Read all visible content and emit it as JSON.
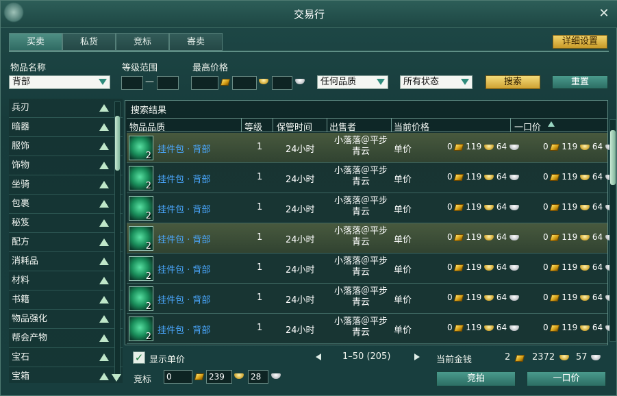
{
  "window": {
    "title": "交易行"
  },
  "tabs": [
    {
      "label": "买卖",
      "active": true
    },
    {
      "label": "私货",
      "active": false
    },
    {
      "label": "竞标",
      "active": false
    },
    {
      "label": "寄卖",
      "active": false
    }
  ],
  "detail_settings_label": "详细设置",
  "filters": {
    "item_name_label": "物品名称",
    "item_name_value": "背部",
    "level_range_label": "等级范围",
    "level_dash": "—",
    "level_min": "",
    "level_max": "",
    "max_price_label": "最高价格",
    "max_price_gold": "",
    "max_price_silver": "",
    "max_price_copper": "",
    "quality_value": "任何品质",
    "status_value": "所有状态",
    "search_label": "搜索",
    "reset_label": "重置"
  },
  "categories": [
    "兵刃",
    "暗器",
    "服饰",
    "饰物",
    "坐骑",
    "包裹",
    "秘笈",
    "配方",
    "消耗品",
    "材料",
    "书籍",
    "物品强化",
    "帮会产物",
    "宝石",
    "宝箱"
  ],
  "results": {
    "title": "搜索结果",
    "columns": [
      "物品品质",
      "等级",
      "保管时间",
      "出售者",
      "当前价格",
      "一口价"
    ],
    "rows": [
      {
        "qty": "2",
        "name": "挂件包 · 背部",
        "level": "1",
        "time": "24小时",
        "seller_line1": "小落落＠平步",
        "seller_line2": "青云",
        "price_label": "单价",
        "cur_gold": "0",
        "cur_silver": "119",
        "cur_copper": "64",
        "buy_gold": "0",
        "buy_silver": "119",
        "buy_copper": "64",
        "selected": true
      },
      {
        "qty": "2",
        "name": "挂件包 · 背部",
        "level": "1",
        "time": "24小时",
        "seller_line1": "小落落＠平步",
        "seller_line2": "青云",
        "price_label": "单价",
        "cur_gold": "0",
        "cur_silver": "119",
        "cur_copper": "64",
        "buy_gold": "0",
        "buy_silver": "119",
        "buy_copper": "64",
        "selected": false
      },
      {
        "qty": "2",
        "name": "挂件包 · 背部",
        "level": "1",
        "time": "24小时",
        "seller_line1": "小落落＠平步",
        "seller_line2": "青云",
        "price_label": "单价",
        "cur_gold": "0",
        "cur_silver": "119",
        "cur_copper": "64",
        "buy_gold": "0",
        "buy_silver": "119",
        "buy_copper": "64",
        "selected": false
      },
      {
        "qty": "2",
        "name": "挂件包 · 背部",
        "level": "1",
        "time": "24小时",
        "seller_line1": "小落落＠平步",
        "seller_line2": "青云",
        "price_label": "单价",
        "cur_gold": "0",
        "cur_silver": "119",
        "cur_copper": "64",
        "buy_gold": "0",
        "buy_silver": "119",
        "buy_copper": "64",
        "selected": true
      },
      {
        "qty": "2",
        "name": "挂件包 · 背部",
        "level": "1",
        "time": "24小时",
        "seller_line1": "小落落＠平步",
        "seller_line2": "青云",
        "price_label": "单价",
        "cur_gold": "0",
        "cur_silver": "119",
        "cur_copper": "64",
        "buy_gold": "0",
        "buy_silver": "119",
        "buy_copper": "64",
        "selected": false
      },
      {
        "qty": "2",
        "name": "挂件包 · 背部",
        "level": "1",
        "time": "24小时",
        "seller_line1": "小落落＠平步",
        "seller_line2": "青云",
        "price_label": "单价",
        "cur_gold": "0",
        "cur_silver": "119",
        "cur_copper": "64",
        "buy_gold": "0",
        "buy_silver": "119",
        "buy_copper": "64",
        "selected": false
      },
      {
        "qty": "2",
        "name": "挂件包 · 背部",
        "level": "1",
        "time": "24小时",
        "seller_line1": "小落落＠平步",
        "seller_line2": "青云",
        "price_label": "单价",
        "cur_gold": "0",
        "cur_silver": "119",
        "cur_copper": "64",
        "buy_gold": "0",
        "buy_silver": "119",
        "buy_copper": "64",
        "selected": false
      }
    ]
  },
  "footer": {
    "show_unit_price_label": "显示单价",
    "show_unit_price_checked": true,
    "pagination": "1–50 (205)",
    "current_money_label": "当前金钱",
    "money_gold": "2",
    "money_silver": "2372",
    "money_copper": "57",
    "bid_label": "竞标",
    "bid_gold": "0",
    "bid_silver": "239",
    "bid_copper": "28",
    "bid_button_label": "竞拍",
    "buyout_button_label": "一口价"
  },
  "colors": {
    "accent_gold": "#f0d36a",
    "item_link": "#4aa8ff",
    "panel_teal": "#1f4a48"
  }
}
